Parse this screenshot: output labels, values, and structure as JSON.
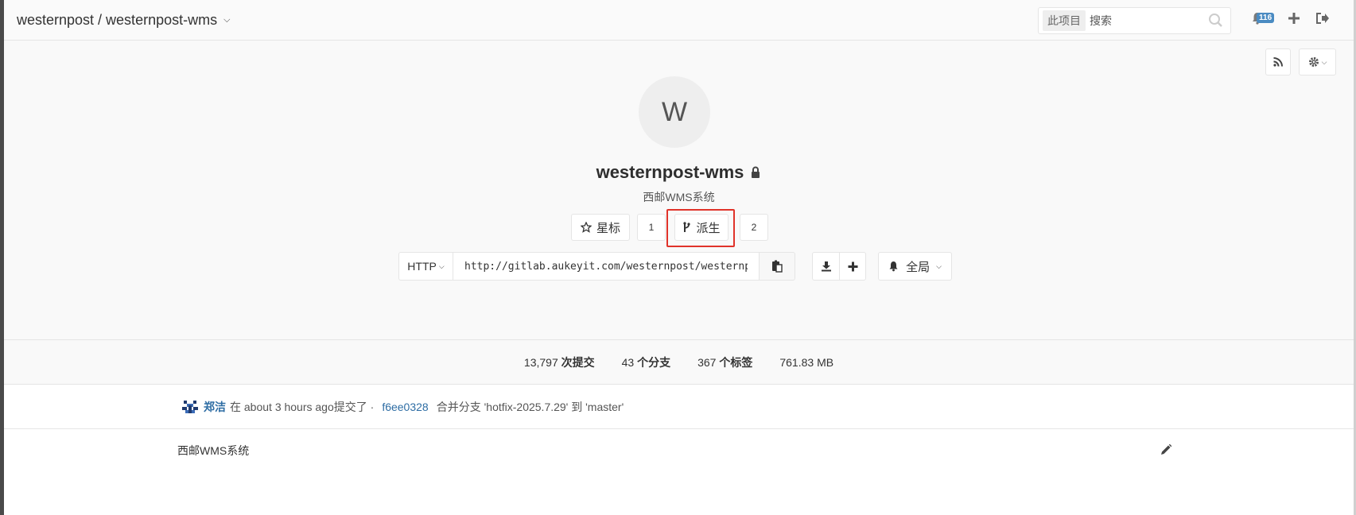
{
  "header": {
    "breadcrumb": "westernpost / westernpost-wms",
    "search_scope": "此项目",
    "search_placeholder": "搜索",
    "notification_count": "116"
  },
  "project": {
    "avatar_letter": "W",
    "name": "westernpost-wms",
    "description": "西邮WMS系统"
  },
  "actions": {
    "star_label": "星标",
    "star_count": "1",
    "fork_label": "派生",
    "fork_count": "2",
    "clone_protocol": "HTTP",
    "clone_url": "http://gitlab.aukeyit.com/westernpost/westernpost-wms.git",
    "notification_level": "全局"
  },
  "stats": {
    "commits_num": "13,797",
    "commits_label": "次提交",
    "branches_num": "43",
    "branches_label": "个分支",
    "tags_num": "367",
    "tags_label": "个标签",
    "size": "761.83 MB"
  },
  "last_commit": {
    "author": "郑洁",
    "prefix": "在 about 3 hours ago提交了 ·",
    "sha": "f6ee0328",
    "message": "合并分支 'hotfix-2025.7.29' 到 'master'"
  },
  "readme": {
    "text": "西邮WMS系统"
  },
  "colors": {
    "link": "#2e6da4",
    "highlight": "#e0332a",
    "badge": "#4a8bc2"
  }
}
